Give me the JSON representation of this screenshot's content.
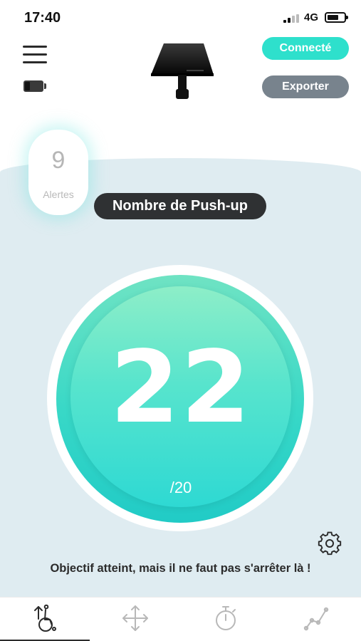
{
  "status_bar": {
    "time": "17:40",
    "network": "4G",
    "phone_battery_level": 0.7
  },
  "header": {
    "menu_icon": "hamburger-menu-icon",
    "device_battery_level": 0.3,
    "device_image": "sensor-device-icon",
    "connected_label": "Connecté",
    "export_label": "Exporter"
  },
  "alerts": {
    "count": "9",
    "label": "Alertes"
  },
  "metric": {
    "title": "Nombre de Push-up",
    "value": "22",
    "target": "/20"
  },
  "message": "Objectif atteint, mais il ne faut pas s'arrêter là !",
  "tabs": [
    {
      "icon": "wheelchair-pushup-icon",
      "active": true
    },
    {
      "icon": "move-arrows-icon",
      "active": false
    },
    {
      "icon": "stopwatch-icon",
      "active": false
    },
    {
      "icon": "line-chart-icon",
      "active": false
    }
  ],
  "colors": {
    "accent": "#2ee0cc",
    "export_button": "#78838d",
    "panel_background": "#dfecf1",
    "metric_pill": "#2f3133"
  }
}
